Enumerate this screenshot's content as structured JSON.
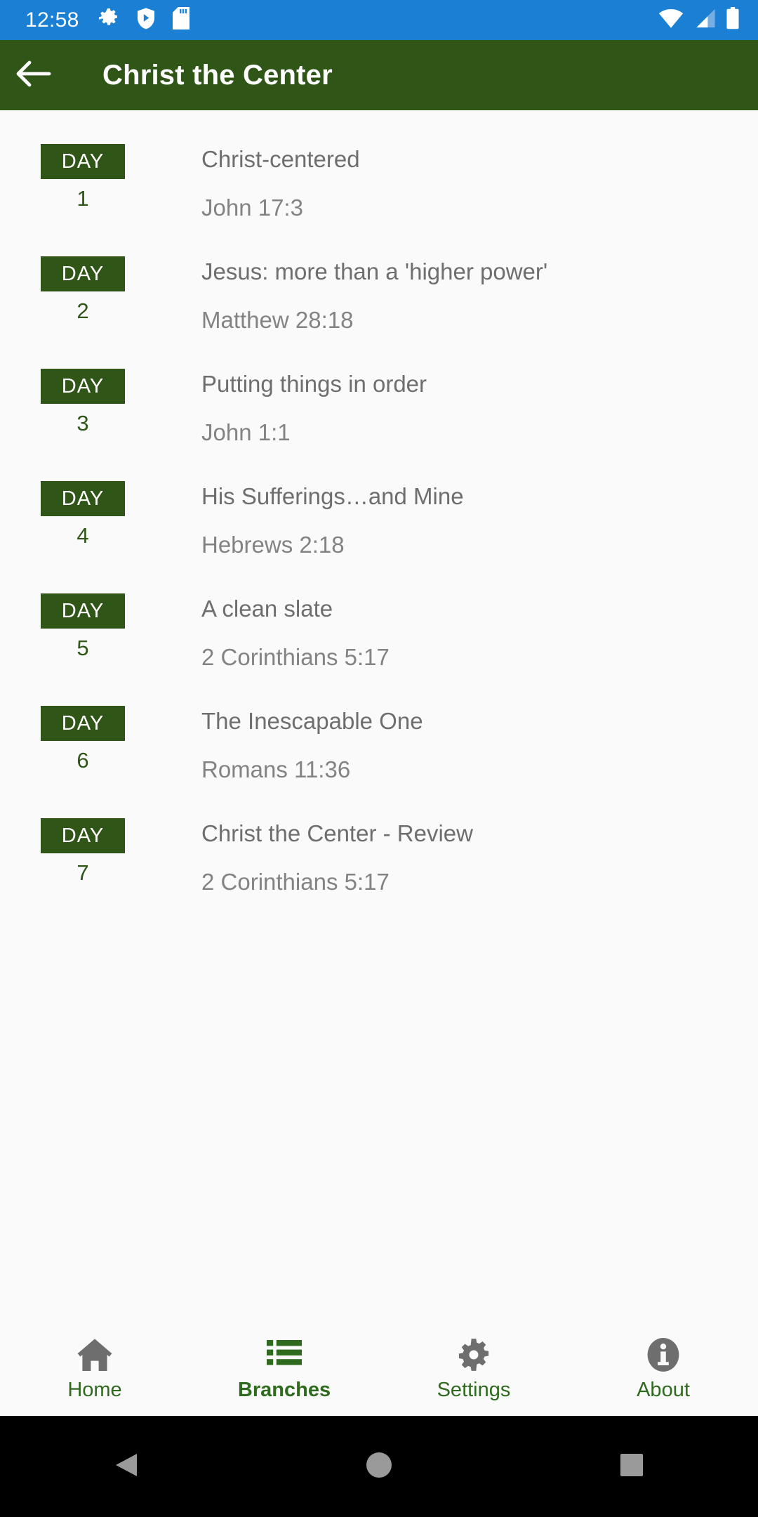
{
  "statusbar": {
    "time": "12:58",
    "left_icons": [
      "gear-icon",
      "play-protect-shield-icon",
      "sd-card-icon"
    ],
    "right_icons": [
      "wifi-icon",
      "cellular-signal-icon",
      "battery-icon"
    ],
    "background": "#1b7fd4"
  },
  "appbar": {
    "back_label": "back-arrow-icon",
    "title": "Christ the Center",
    "background": "#2f5517",
    "text_color": "#ffffff"
  },
  "list": {
    "badge_label": "DAY",
    "accent": "#2f5517",
    "items": [
      {
        "day": "1",
        "title": "Christ-centered",
        "verse": "John 17:3"
      },
      {
        "day": "2",
        "title": "Jesus: more than a 'higher power'",
        "verse": "Matthew 28:18"
      },
      {
        "day": "3",
        "title": "Putting things in order",
        "verse": "John 1:1"
      },
      {
        "day": "4",
        "title": "His Sufferings…and Mine",
        "verse": "Hebrews 2:18"
      },
      {
        "day": "5",
        "title": "A clean slate",
        "verse": "2 Corinthians 5:17"
      },
      {
        "day": "6",
        "title": "The Inescapable One",
        "verse": "Romans 11:36"
      },
      {
        "day": "7",
        "title": "Christ the Center - Review",
        "verse": "2 Corinthians 5:17"
      }
    ]
  },
  "bottomnav": {
    "active_index": 1,
    "label_color": "#2f6b1f",
    "inactive_icon_color": "#6e6e6e",
    "active_icon_color": "#2f6b1f",
    "items": [
      {
        "label": "Home",
        "icon": "home-icon"
      },
      {
        "label": "Branches",
        "icon": "list-icon"
      },
      {
        "label": "Settings",
        "icon": "gear-icon"
      },
      {
        "label": "About",
        "icon": "info-icon"
      }
    ]
  },
  "androidnav": {
    "background": "#000000",
    "buttons": [
      {
        "name": "back-triangle-icon"
      },
      {
        "name": "home-circle-icon"
      },
      {
        "name": "recents-square-icon"
      }
    ]
  }
}
